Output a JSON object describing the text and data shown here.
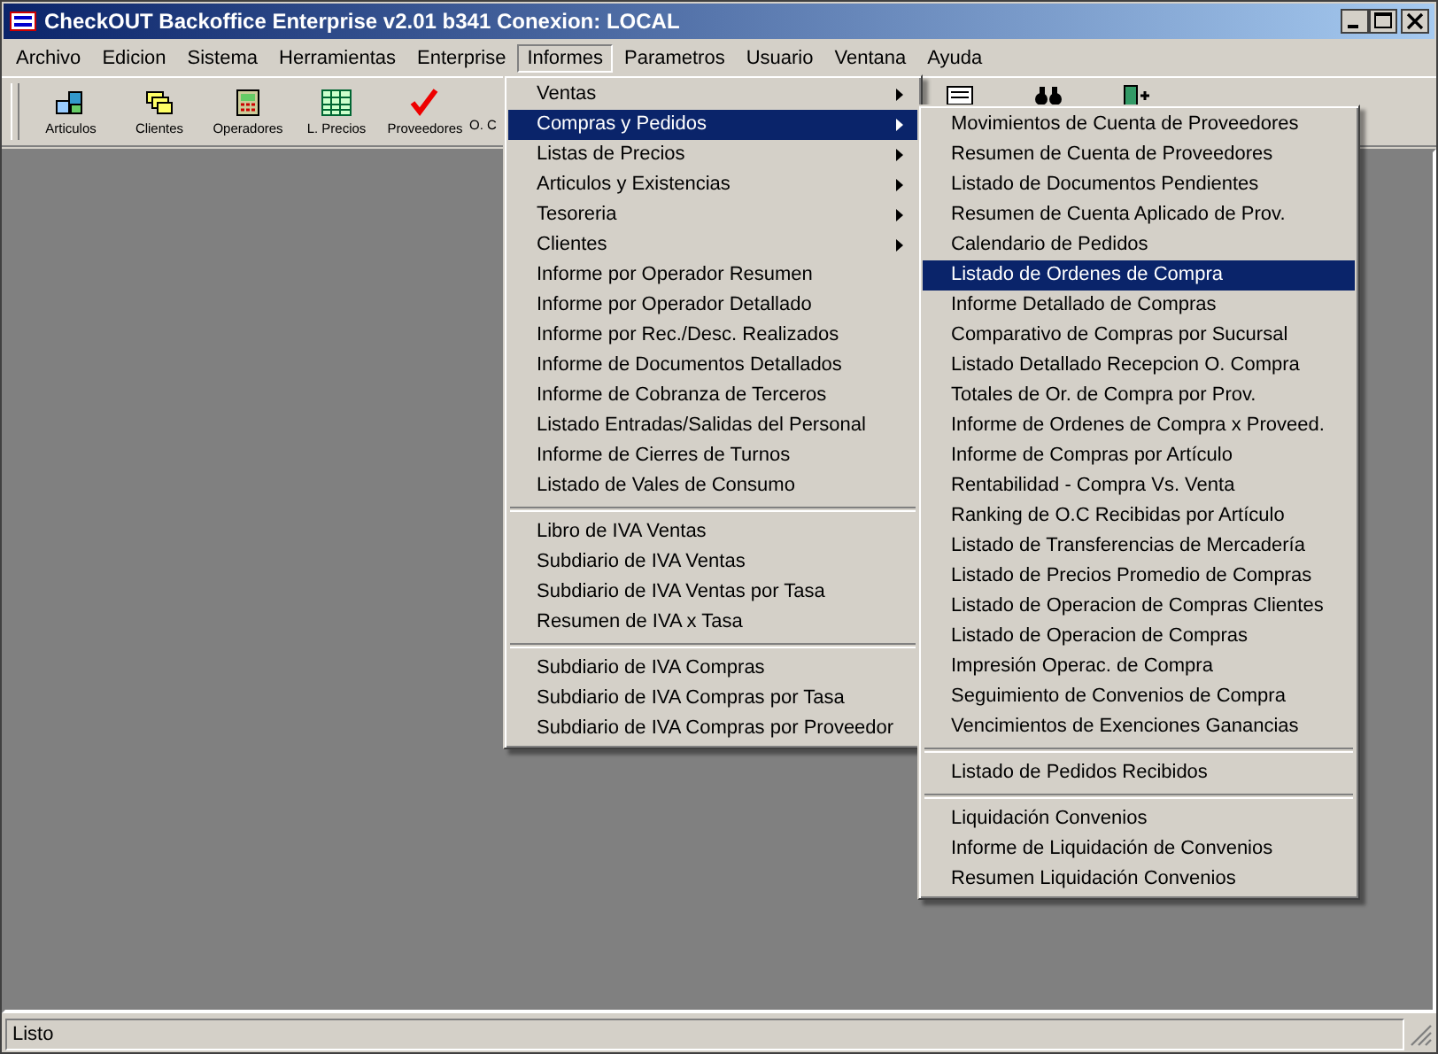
{
  "window": {
    "title": "CheckOUT Backoffice Enterprise v2.01 b341 Conexion: LOCAL"
  },
  "menu_bar": [
    {
      "label": "Archivo",
      "selected": false
    },
    {
      "label": "Edicion",
      "selected": false
    },
    {
      "label": "Sistema",
      "selected": false
    },
    {
      "label": "Herramientas",
      "selected": false
    },
    {
      "label": "Enterprise",
      "selected": false
    },
    {
      "label": "Informes",
      "selected": true
    },
    {
      "label": "Parametros",
      "selected": false
    },
    {
      "label": "Usuario",
      "selected": false
    },
    {
      "label": "Ventana",
      "selected": false
    },
    {
      "label": "Ayuda",
      "selected": false
    }
  ],
  "toolbar": [
    {
      "label": "Articulos",
      "kind": "boxes"
    },
    {
      "label": "Clientes",
      "kind": "people"
    },
    {
      "label": "Operadores",
      "kind": "operator"
    },
    {
      "label": "L. Precios",
      "kind": "table"
    },
    {
      "label": "Proveedores",
      "kind": "check"
    },
    {
      "label": "O. C",
      "kind": "none"
    }
  ],
  "informes_menu": [
    {
      "kind": "item",
      "label": "Ventas",
      "submenu": true,
      "selected": false
    },
    {
      "kind": "item",
      "label": "Compras y Pedidos",
      "submenu": true,
      "selected": true
    },
    {
      "kind": "item",
      "label": "Listas de Precios",
      "submenu": true,
      "selected": false
    },
    {
      "kind": "item",
      "label": "Articulos y Existencias",
      "submenu": true,
      "selected": false
    },
    {
      "kind": "item",
      "label": "Tesoreria",
      "submenu": true,
      "selected": false
    },
    {
      "kind": "item",
      "label": "Clientes",
      "submenu": true,
      "selected": false
    },
    {
      "kind": "item",
      "label": "Informe por Operador Resumen",
      "submenu": false,
      "selected": false
    },
    {
      "kind": "item",
      "label": "Informe por Operador Detallado",
      "submenu": false,
      "selected": false
    },
    {
      "kind": "item",
      "label": "Informe por Rec./Desc. Realizados",
      "submenu": false,
      "selected": false
    },
    {
      "kind": "item",
      "label": "Informe de Documentos Detallados",
      "submenu": false,
      "selected": false
    },
    {
      "kind": "item",
      "label": "Informe de Cobranza de Terceros",
      "submenu": false,
      "selected": false
    },
    {
      "kind": "item",
      "label": "Listado Entradas/Salidas del Personal",
      "submenu": false,
      "selected": false
    },
    {
      "kind": "item",
      "label": "Informe de Cierres de Turnos",
      "submenu": false,
      "selected": false
    },
    {
      "kind": "item",
      "label": "Listado de Vales de Consumo",
      "submenu": false,
      "selected": false
    },
    {
      "kind": "separator"
    },
    {
      "kind": "item",
      "label": "Libro de IVA Ventas",
      "submenu": false,
      "selected": false
    },
    {
      "kind": "item",
      "label": "Subdiario de IVA Ventas",
      "submenu": false,
      "selected": false
    },
    {
      "kind": "item",
      "label": "Subdiario de IVA Ventas por Tasa",
      "submenu": false,
      "selected": false
    },
    {
      "kind": "item",
      "label": "Resumen de IVA x Tasa",
      "submenu": false,
      "selected": false
    },
    {
      "kind": "separator"
    },
    {
      "kind": "item",
      "label": "Subdiario de IVA Compras",
      "submenu": false,
      "selected": false
    },
    {
      "kind": "item",
      "label": "Subdiario de IVA Compras por Tasa",
      "submenu": false,
      "selected": false
    },
    {
      "kind": "item",
      "label": "Subdiario de IVA Compras por Proveedor",
      "submenu": false,
      "selected": false
    }
  ],
  "compras_submenu": [
    {
      "kind": "item",
      "label": "Movimientos de Cuenta de Proveedores",
      "selected": false
    },
    {
      "kind": "item",
      "label": "Resumen de Cuenta de Proveedores",
      "selected": false
    },
    {
      "kind": "item",
      "label": "Listado de Documentos Pendientes",
      "selected": false
    },
    {
      "kind": "item",
      "label": "Resumen de Cuenta Aplicado de Prov.",
      "selected": false
    },
    {
      "kind": "item",
      "label": "Calendario de Pedidos",
      "selected": false
    },
    {
      "kind": "item",
      "label": "Listado de Ordenes de Compra",
      "selected": true
    },
    {
      "kind": "item",
      "label": "Informe Detallado de Compras",
      "selected": false
    },
    {
      "kind": "item",
      "label": "Comparativo de Compras por Sucursal",
      "selected": false
    },
    {
      "kind": "item",
      "label": "Listado Detallado Recepcion O. Compra",
      "selected": false
    },
    {
      "kind": "item",
      "label": "Totales de Or. de Compra por Prov.",
      "selected": false
    },
    {
      "kind": "item",
      "label": "Informe de Ordenes de Compra x Proveed.",
      "selected": false
    },
    {
      "kind": "item",
      "label": "Informe de Compras por Artículo",
      "selected": false
    },
    {
      "kind": "item",
      "label": "Rentabilidad - Compra Vs. Venta",
      "selected": false
    },
    {
      "kind": "item",
      "label": "Ranking de O.C Recibidas por Artículo",
      "selected": false
    },
    {
      "kind": "item",
      "label": "Listado de Transferencias de Mercadería",
      "selected": false
    },
    {
      "kind": "item",
      "label": "Listado de Precios Promedio de Compras",
      "selected": false
    },
    {
      "kind": "item",
      "label": "Listado de Operacion de Compras Clientes",
      "selected": false
    },
    {
      "kind": "item",
      "label": "Listado de Operacion de Compras",
      "selected": false
    },
    {
      "kind": "item",
      "label": "Impresión Operac. de Compra",
      "selected": false
    },
    {
      "kind": "item",
      "label": "Seguimiento de Convenios de Compra",
      "selected": false
    },
    {
      "kind": "item",
      "label": "Vencimientos de Exenciones Ganancias",
      "selected": false
    },
    {
      "kind": "separator"
    },
    {
      "kind": "item",
      "label": "Listado de Pedidos Recibidos",
      "selected": false
    },
    {
      "kind": "separator"
    },
    {
      "kind": "item",
      "label": "Liquidación Convenios",
      "selected": false
    },
    {
      "kind": "item",
      "label": "Informe de Liquidación de Convenios",
      "selected": false
    },
    {
      "kind": "item",
      "label": "Resumen Liquidación Convenios",
      "selected": false
    }
  ],
  "status_bar": {
    "text": "Listo"
  }
}
